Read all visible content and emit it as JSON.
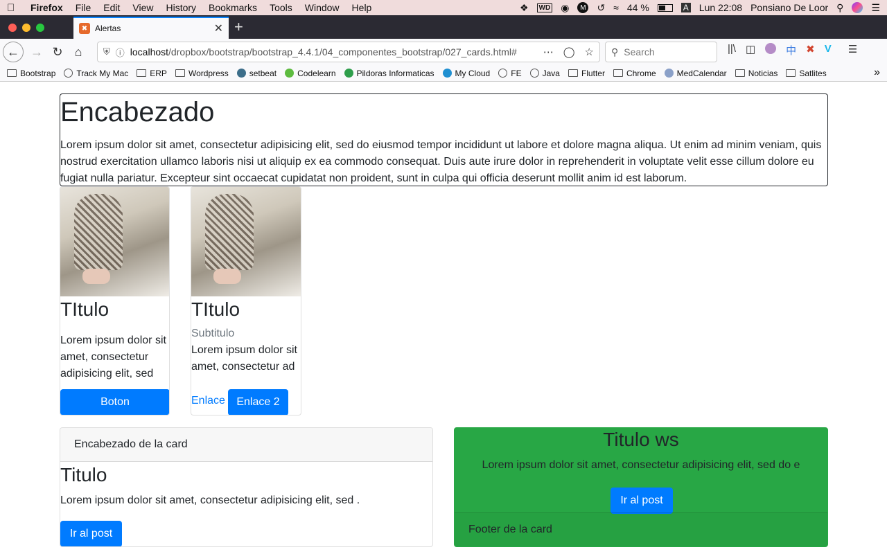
{
  "menubar": {
    "app": "Firefox",
    "items": [
      "File",
      "Edit",
      "View",
      "History",
      "Bookmarks",
      "Tools",
      "Window",
      "Help"
    ],
    "battery": "44 %",
    "input": "A",
    "clock": "Lun 22:08",
    "user": "Ponsiano De Loor"
  },
  "tab": {
    "title": "Alertas"
  },
  "navbar": {
    "url_host": "localhost",
    "url_path": "/dropbox/bootstrap/bootstrap_4.4.1/04_componentes_bootstrap/027_cards.html#",
    "search_placeholder": "Search"
  },
  "bookmarks": [
    {
      "label": "Bootstrap",
      "icon": "folder-icon"
    },
    {
      "label": "Track My Mac",
      "icon": "globe-icon"
    },
    {
      "label": "ERP",
      "icon": "folder-icon"
    },
    {
      "label": "Wordpress",
      "icon": "folder-icon"
    },
    {
      "label": "setbeat",
      "icon": "setbeat-icon"
    },
    {
      "label": "Codelearn",
      "icon": "codelearn-icon"
    },
    {
      "label": "Pildoras Informaticas",
      "icon": "pildoras-icon"
    },
    {
      "label": "My Cloud",
      "icon": "cloud-icon"
    },
    {
      "label": "FE",
      "icon": "globe-icon"
    },
    {
      "label": "Java",
      "icon": "globe-icon"
    },
    {
      "label": "Flutter",
      "icon": "folder-icon"
    },
    {
      "label": "Chrome",
      "icon": "folder-icon"
    },
    {
      "label": "MedCalendar",
      "icon": "medcalendar-icon"
    },
    {
      "label": "Noticias",
      "icon": "folder-icon"
    },
    {
      "label": "Satlites",
      "icon": "folder-icon"
    }
  ],
  "jumbotron": {
    "title": "Encabezado",
    "text": "Lorem ipsum dolor sit amet, consectetur adipisicing elit, sed do eiusmod tempor incididunt ut labore et dolore magna aliqua. Ut enim ad minim veniam, quis nostrud exercitation ullamco laboris nisi ut aliquip ex ea commodo consequat. Duis aute irure dolor in reprehenderit in voluptate velit esse cillum dolore eu fugiat nulla pariatur. Excepteur sint occaecat cupidatat non proident, sunt in culpa qui officia deserunt mollit anim id est laborum."
  },
  "card1": {
    "title": "TItulo",
    "text": "Lorem ipsum dolor sit amet, consectetur adipisicing elit, sed",
    "button": "Boton"
  },
  "card2": {
    "title": "TItulo",
    "subtitle": "Subtitulo",
    "text": "Lorem ipsum dolor sit amet, consectetur ad",
    "link": "Enlace",
    "button": "Enlace 2"
  },
  "card3": {
    "header": "Encabezado de la card",
    "title": "Titulo",
    "text": "Lorem ipsum dolor sit amet, consectetur adipisicing elit, sed .",
    "button": "Ir al post"
  },
  "card4": {
    "title": "Titulo ws",
    "text": "Lorem ipsum dolor sit amet, consectetur adipisicing elit, sed do e",
    "button": "Ir al post",
    "footer": "Footer de la card"
  }
}
